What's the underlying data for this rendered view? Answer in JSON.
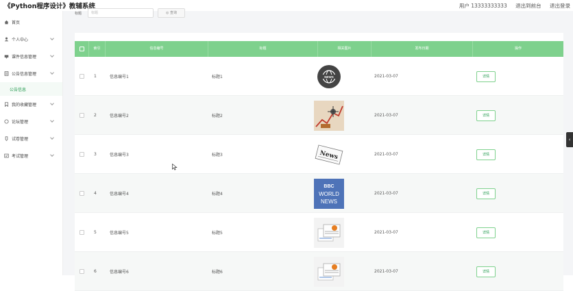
{
  "header": {
    "title": "《Python程序设计》教辅系统",
    "user": "用户 13333333333",
    "back_link": "退出到前台",
    "logout": "退出登录"
  },
  "sidebar": {
    "items": [
      {
        "label": "首页",
        "icon": "home-icon",
        "chevron": false
      },
      {
        "label": "个人中心",
        "icon": "user-icon",
        "chevron": true
      },
      {
        "label": "课件信息管理",
        "icon": "courseware-icon",
        "chevron": true
      },
      {
        "label": "公告信息管理",
        "icon": "notice-icon",
        "chevron": true
      },
      {
        "label": "我的收藏管理",
        "icon": "bookmark-icon",
        "chevron": true
      },
      {
        "label": "论坛管理",
        "icon": "forum-icon",
        "chevron": true
      },
      {
        "label": "试卷管理",
        "icon": "paper-icon",
        "chevron": true
      },
      {
        "label": "考试管理",
        "icon": "exam-icon",
        "chevron": true
      }
    ],
    "submenu_active": "公告信息"
  },
  "search": {
    "label": "标题",
    "placeholder": "标题",
    "button": "◎ 查询"
  },
  "table": {
    "headers": [
      "",
      "索引",
      "信息编号",
      "标题",
      "相关图片",
      "发布日期",
      "操作"
    ],
    "rows": [
      {
        "index": "1",
        "code": "信息编号1",
        "title": "标题1",
        "image": "globe-news-icon",
        "date": "2021-03-07",
        "action": "详情"
      },
      {
        "index": "2",
        "code": "信息编号2",
        "title": "标题2",
        "image": "chart-news-icon",
        "date": "2021-03-07",
        "action": "详情"
      },
      {
        "index": "3",
        "code": "信息编号3",
        "title": "标题3",
        "image": "newspaper-icon",
        "date": "2021-03-07",
        "action": "详情"
      },
      {
        "index": "4",
        "code": "信息编号4",
        "title": "标题4",
        "image": "bbc-world-news-icon",
        "date": "2021-03-07",
        "action": "详情"
      },
      {
        "index": "5",
        "code": "信息编号5",
        "title": "标题5",
        "image": "news-papers-icon",
        "date": "2021-03-07",
        "action": "详情"
      },
      {
        "index": "6",
        "code": "信息编号6",
        "title": "标题6",
        "image": "news-papers-icon",
        "date": "2021-03-07",
        "action": "详情"
      }
    ],
    "bbc_text": {
      "line1": "BBC",
      "line2": "WORLD",
      "line3": "NEWS"
    },
    "news_text": "News"
  },
  "colors": {
    "header_green": "#7ed18d",
    "accent_green": "#2a9d54"
  }
}
